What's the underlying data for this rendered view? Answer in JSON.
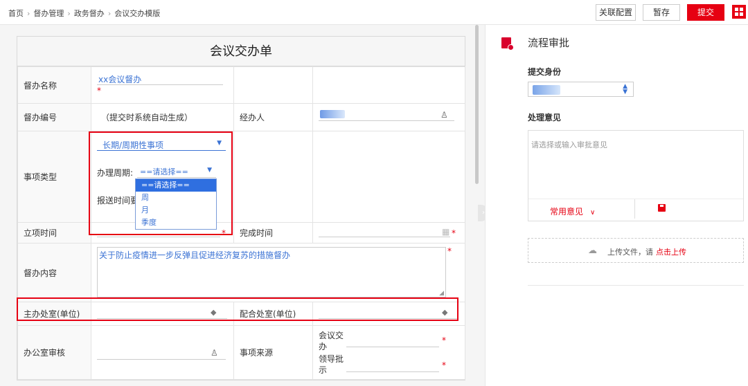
{
  "breadcrumb": {
    "items": [
      "首页",
      "督办管理",
      "政务督办",
      "会议交办模版"
    ],
    "separator": "›"
  },
  "toolbar": {
    "related_label": "关联配置",
    "draft_label": "暂存",
    "submit_label": "提交"
  },
  "colors": {
    "accent": "#e60012",
    "link": "#3b73d4"
  },
  "form": {
    "title": "会议交办单",
    "name_label": "督办名称",
    "name_value": "xx会议督办",
    "required_mark": "*",
    "code_label": "督办编号",
    "code_value": "（提交时系统自动生成）",
    "handler_label": "经办人",
    "type_label": "事项类型",
    "type_value": "长期/周期性事项",
    "cycle_label": "办理周期:",
    "cycle_value": "==请选择==",
    "report_label": "报送时间要",
    "cycle_options": [
      "==请选择==",
      "周",
      "月",
      "季度"
    ],
    "start_label": "立项时间",
    "finish_label": "完成时间",
    "content_label": "督办内容",
    "content_value": "关于防止疫情进一步反弹且促进经济复苏的措施督办",
    "lead_dept_label": "主办处室(单位)",
    "coop_dept_label": "配合处室(单位)",
    "office_review_label": "办公室审核",
    "source_label": "事项来源",
    "source_opt1": "会议交办",
    "source_opt2": "领导批示"
  },
  "flow": {
    "title": "流程审批",
    "identity_label": "提交身份",
    "opinion_label": "处理意见",
    "opinion_placeholder": "请选择或输入审批意见",
    "common_label": "常用意见",
    "upload_text": "上传文件，请",
    "upload_link": "点击上传"
  }
}
